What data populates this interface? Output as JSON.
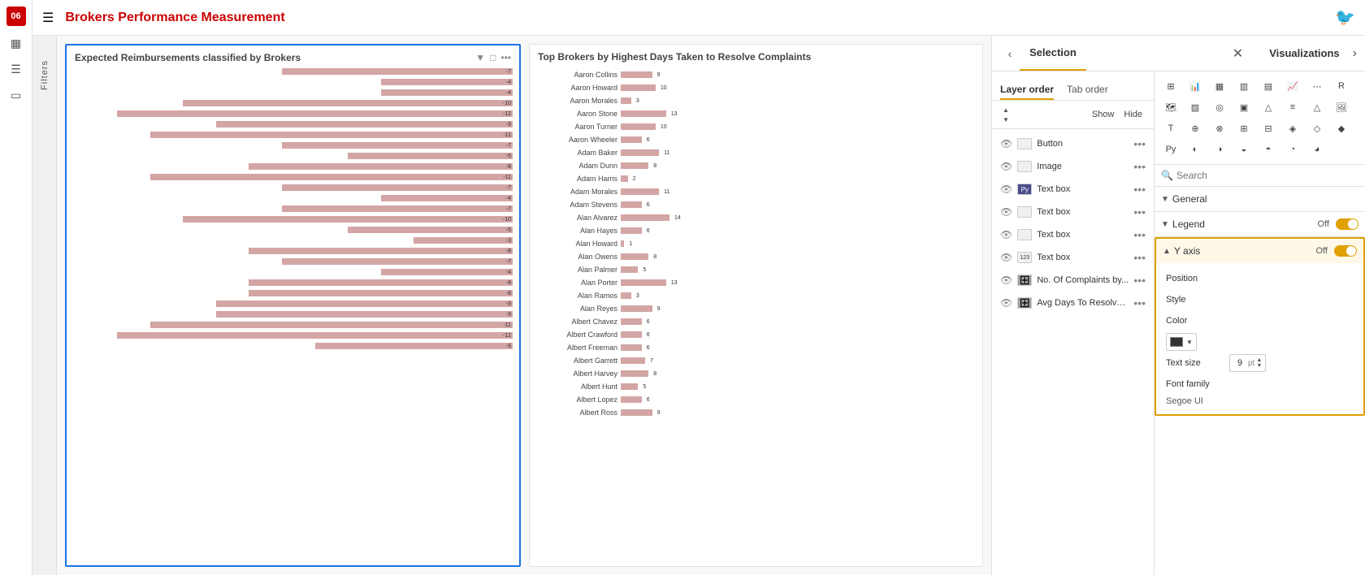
{
  "page": {
    "page_number": "06",
    "title": "Brokers Performance Measurement"
  },
  "left_sidebar": {
    "icons": [
      "grid",
      "list",
      "layers"
    ]
  },
  "filters": {
    "label": "Filters"
  },
  "chart1": {
    "title": "Expected Reimbursements classified by Brokers",
    "bars": [
      {
        "value": -7
      },
      {
        "value": -4
      },
      {
        "value": -4
      },
      {
        "value": -10
      },
      {
        "value": -12
      },
      {
        "value": -9
      },
      {
        "value": -11
      },
      {
        "value": -7
      },
      {
        "value": -5
      },
      {
        "value": -8
      },
      {
        "value": -11
      },
      {
        "value": -7
      },
      {
        "value": -4
      },
      {
        "value": -7
      },
      {
        "value": -10
      },
      {
        "value": -5
      },
      {
        "value": -3
      },
      {
        "value": -8
      },
      {
        "value": -7
      },
      {
        "value": -4
      },
      {
        "value": -8
      },
      {
        "value": -8
      },
      {
        "value": -9
      },
      {
        "value": -9
      },
      {
        "value": -11
      },
      {
        "value": -12
      },
      {
        "value": -6
      }
    ]
  },
  "chart2": {
    "title": "Top Brokers by Highest Days Taken to Resolve Complaints",
    "brokers": [
      {
        "name": "Aaron Collins",
        "value": 9
      },
      {
        "name": "Aaron Howard",
        "value": 10
      },
      {
        "name": "Aaron Morales",
        "value": 3
      },
      {
        "name": "Aaron Stone",
        "value": 13
      },
      {
        "name": "Aaron Turner",
        "value": 10
      },
      {
        "name": "Aaron Wheeler",
        "value": 6
      },
      {
        "name": "Adam Baker",
        "value": 11
      },
      {
        "name": "Adam Dunn",
        "value": 8
      },
      {
        "name": "Adam Harris",
        "value": 2
      },
      {
        "name": "Adam Morales",
        "value": 11
      },
      {
        "name": "Adam Stevens",
        "value": 6
      },
      {
        "name": "Alan Alvarez",
        "value": 14
      },
      {
        "name": "Alan Hayes",
        "value": 6
      },
      {
        "name": "Alan Howard",
        "value": 1
      },
      {
        "name": "Alan Owens",
        "value": 8
      },
      {
        "name": "Alan Palmer",
        "value": 5
      },
      {
        "name": "Alan Porter",
        "value": 13
      },
      {
        "name": "Alan Ramos",
        "value": 3
      },
      {
        "name": "Alan Reyes",
        "value": 9
      },
      {
        "name": "Albert Chavez",
        "value": 6
      },
      {
        "name": "Albert Crawford",
        "value": 6
      },
      {
        "name": "Albert Freeman",
        "value": 6
      },
      {
        "name": "Albert Garrett",
        "value": 7
      },
      {
        "name": "Albert Harvey",
        "value": 8
      },
      {
        "name": "Albert Hunt",
        "value": 5
      },
      {
        "name": "Albert Lopez",
        "value": 6
      },
      {
        "name": "Albert Ross",
        "value": 9
      }
    ]
  },
  "selection_panel": {
    "title": "Selection",
    "visualizations_title": "Visualizations",
    "tabs": {
      "layer_order": "Layer order",
      "tab_order": "Tab order"
    },
    "show_hide": {
      "show": "Show",
      "hide": "Hide"
    },
    "layers": [
      {
        "name": "Button",
        "icon_type": "box",
        "visible": true
      },
      {
        "name": "Image",
        "icon_type": "box",
        "visible": true
      },
      {
        "name": "Text box",
        "icon_type": "py",
        "visible": true
      },
      {
        "name": "Text box",
        "icon_type": "box",
        "visible": true
      },
      {
        "name": "Text box",
        "icon_type": "box",
        "visible": true
      },
      {
        "name": "Text box",
        "icon_type": "num",
        "visible": true
      },
      {
        "name": "No. Of Complaints by...",
        "icon_type": "table",
        "visible": true,
        "highlighted": false
      },
      {
        "name": "Avg Days To Resolve ...",
        "icon_type": "table",
        "visible": true,
        "highlighted": false
      }
    ]
  },
  "viz_panel": {
    "search_placeholder": "Search",
    "sections": {
      "general": "General",
      "legend": {
        "title": "Legend",
        "value": "Off"
      },
      "y_axis": {
        "title": "Y axis",
        "value": "Off"
      }
    },
    "y_axis_props": {
      "position_label": "Position",
      "style_label": "Style",
      "color_label": "Color",
      "text_size_label": "Text size",
      "text_size_value": "9",
      "text_size_unit": "pt",
      "font_family_label": "Font family",
      "font_family_value": "Segoe UI"
    }
  }
}
